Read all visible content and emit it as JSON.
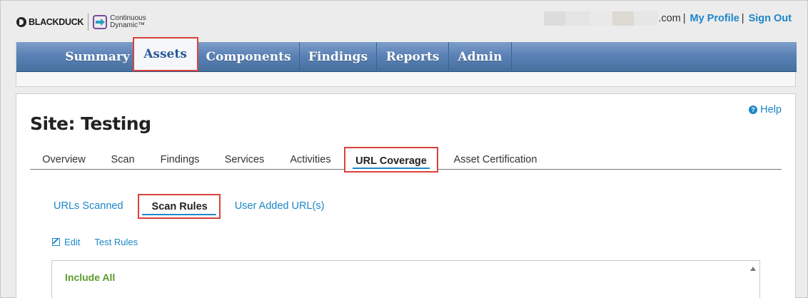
{
  "header": {
    "brand": "BLACKDUCK",
    "product_line1": "Continuous",
    "product_line2": "Dynamic™",
    "user_email_suffix": ".com",
    "separator": "|",
    "my_profile": "My Profile",
    "sign_out": "Sign Out"
  },
  "nav": {
    "items": [
      {
        "label": "Summary"
      },
      {
        "label": "Assets"
      },
      {
        "label": "Components"
      },
      {
        "label": "Findings"
      },
      {
        "label": "Reports"
      },
      {
        "label": "Admin"
      }
    ],
    "active": "Assets"
  },
  "page": {
    "help": "Help",
    "title": "Site: Testing"
  },
  "tabs": {
    "items": [
      {
        "label": "Overview"
      },
      {
        "label": "Scan"
      },
      {
        "label": "Findings"
      },
      {
        "label": "Services"
      },
      {
        "label": "Activities"
      },
      {
        "label": "URL Coverage"
      },
      {
        "label": "Asset Certification"
      }
    ],
    "active": "URL Coverage"
  },
  "subtabs": {
    "items": [
      {
        "label": "URLs Scanned"
      },
      {
        "label": "Scan Rules"
      },
      {
        "label": "User Added URL(s)"
      }
    ],
    "active": "Scan Rules"
  },
  "actions": {
    "edit": "Edit",
    "test_rules": "Test Rules"
  },
  "rules": {
    "lines": [
      "Include All"
    ]
  },
  "colors": {
    "link": "#1b87c9",
    "highlight_border": "#d9423b",
    "rule_green": "#5e9a2e"
  }
}
